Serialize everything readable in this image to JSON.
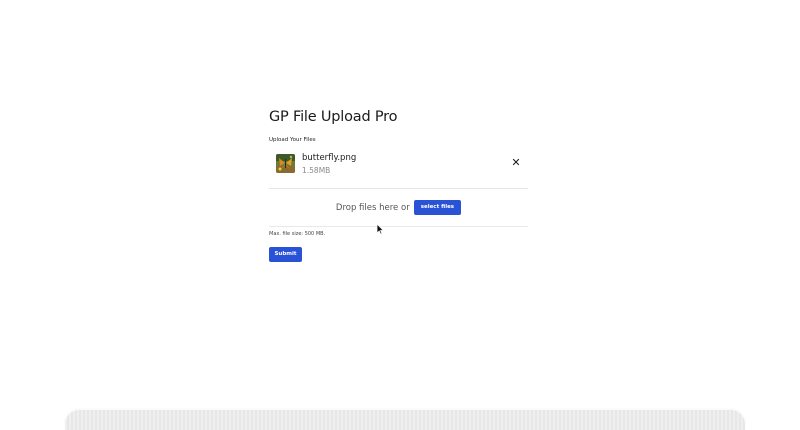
{
  "form": {
    "title": "GP File Upload Pro",
    "field_label": "Upload Your Files",
    "file": {
      "name": "butterfly.png",
      "size": "1.58MB",
      "thumbnail_icon": "image-thumbnail",
      "remove_icon": "close-icon",
      "remove_glyph": "✕"
    },
    "dropzone": {
      "text": "Drop files here or",
      "button_label": "select files"
    },
    "max_size_note": "Max. file size: 500 MB.",
    "submit_label": "Submit"
  },
  "colors": {
    "accent": "#2a52d6",
    "text": "#1b1b1b",
    "muted": "#8a8a8a"
  }
}
